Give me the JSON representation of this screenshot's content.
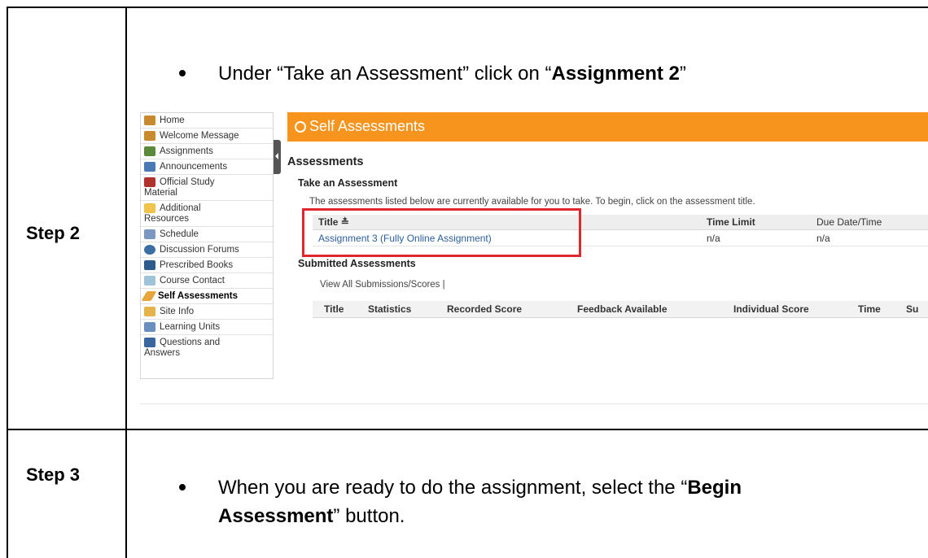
{
  "steps": [
    {
      "label": "Step 2",
      "instruction_pre": "Under “Take an Assessment” click on “",
      "instruction_bold": "Assignment 2",
      "instruction_post": "”"
    },
    {
      "label": "Step 3",
      "instruction_pre": "When you are ready to do the assignment, select the “",
      "instruction_bold": "Begin",
      "instruction_bold2": "Assessment",
      "instruction_post": "” button."
    }
  ],
  "sidebar": {
    "items": [
      {
        "label": "Home",
        "icon": "home-icon"
      },
      {
        "label": "Welcome Message",
        "icon": "home-icon"
      },
      {
        "label": "Assignments",
        "icon": "assignments-icon"
      },
      {
        "label": "Announcements",
        "icon": "announcements-icon"
      },
      {
        "label": "Official Study",
        "label2": "Material",
        "icon": "study-material-icon"
      },
      {
        "label": "Additional",
        "label2": "Resources",
        "icon": "folder-icon"
      },
      {
        "label": "Schedule",
        "icon": "calendar-icon"
      },
      {
        "label": "Discussion Forums",
        "icon": "forum-icon"
      },
      {
        "label": "Prescribed Books",
        "icon": "books-icon"
      },
      {
        "label": "Course Contact",
        "icon": "contact-icon"
      },
      {
        "label": "Self Assessments",
        "icon": "pencil-icon",
        "active": true
      },
      {
        "label": "Site Info",
        "icon": "info-icon"
      },
      {
        "label": "Learning Units",
        "icon": "units-icon"
      },
      {
        "label": "Questions and",
        "label2": "Answers",
        "icon": "qa-icon"
      }
    ]
  },
  "main": {
    "banner_title": "Self Assessments",
    "heading": "Assessments",
    "take_heading": "Take an Assessment",
    "description": "The assessments listed below are currently available for you to take. To begin, click on the assessment title.",
    "take_table": {
      "headers": {
        "title": "Title ≛",
        "time_limit": "Time Limit",
        "due": "Due Date/Time"
      },
      "rows": [
        {
          "title": "Assignment 3 (Fully Online Assignment)",
          "time_limit": "n/a",
          "due": "n/a"
        }
      ]
    },
    "submitted_heading": "Submitted Assessments",
    "view_all": "View All Submissions/Scores |",
    "submitted_headers": [
      "Title",
      "Statistics",
      "Recorded Score",
      "Feedback Available",
      "Individual Score",
      "Time",
      "Su"
    ]
  },
  "colors": {
    "banner": "#f7941d",
    "highlight": "#e0262f",
    "link": "#2a5d9a"
  }
}
